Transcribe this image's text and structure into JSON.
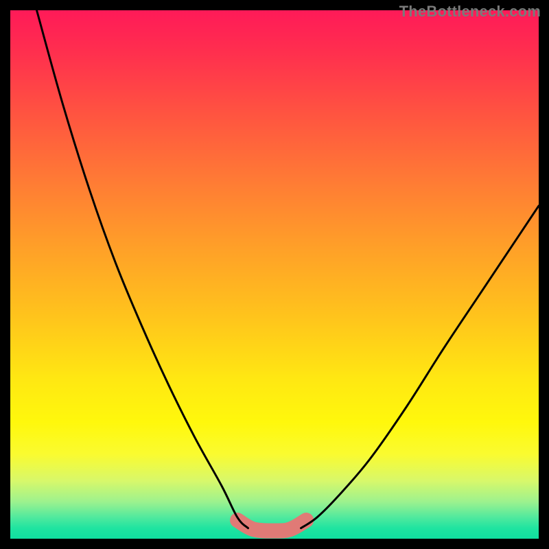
{
  "watermark": "TheBottleneck.com",
  "chart_data": {
    "type": "line",
    "title": "",
    "xlabel": "",
    "ylabel": "",
    "xlim": [
      0,
      100
    ],
    "ylim": [
      0,
      100
    ],
    "grid": false,
    "legend": false,
    "colors": {
      "gradient_top": "#ff1a58",
      "gradient_bottom": "#10dfa0",
      "curve": "#000000",
      "minimum_band": "#e07a76",
      "frame": "#000000"
    },
    "series": [
      {
        "name": "left-curve",
        "x": [
          5,
          10,
          15,
          20,
          25,
          30,
          35,
          40,
          43,
          45
        ],
        "y": [
          100,
          82,
          66,
          52,
          40,
          29,
          19,
          10,
          4,
          2
        ]
      },
      {
        "name": "right-curve",
        "x": [
          55,
          58,
          62,
          68,
          75,
          82,
          90,
          100
        ],
        "y": [
          2,
          4,
          8,
          15,
          25,
          36,
          48,
          63
        ]
      },
      {
        "name": "minimum-band",
        "x": [
          43,
          46,
          50,
          53,
          56
        ],
        "y": [
          3.5,
          1.8,
          1.5,
          1.8,
          3.5
        ]
      }
    ],
    "annotations": []
  }
}
